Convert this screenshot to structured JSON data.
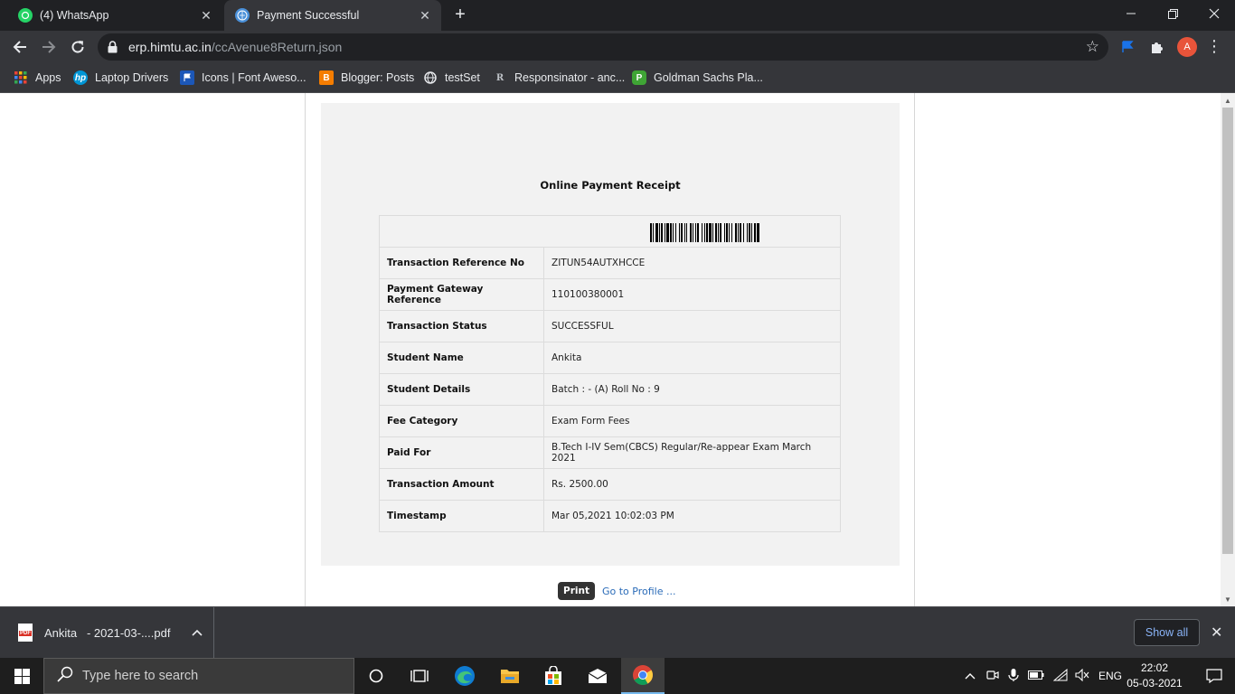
{
  "browser": {
    "tabs": [
      {
        "title": "(4) WhatsApp",
        "icon": "whatsapp-icon"
      },
      {
        "title": "Payment Successful",
        "icon": "site-globe-icon"
      }
    ],
    "url_host": "erp.himtu.ac.in",
    "url_path": "/ccAvenue8Return.json",
    "profile_initial": "A",
    "bookmarks": [
      {
        "label": "Apps",
        "icon": "apps-grid-icon"
      },
      {
        "label": "Laptop Drivers",
        "icon": "hp-logo-icon"
      },
      {
        "label": "Icons | Font Aweso...",
        "icon": "flag-icon"
      },
      {
        "label": "Blogger: Posts",
        "icon": "blogger-icon"
      },
      {
        "label": "testSet",
        "icon": "globe-icon"
      },
      {
        "label": "Responsinator - anc...",
        "icon": "r-logo-icon"
      },
      {
        "label": "Goldman Sachs Pla...",
        "icon": "goldman-sachs-icon"
      }
    ]
  },
  "receipt": {
    "title": "Online Payment Receipt",
    "rows": [
      {
        "label": "Transaction Reference No",
        "value": "ZITUN54AUTXHCCE"
      },
      {
        "label": "Payment Gateway Reference",
        "value": "110100380001"
      },
      {
        "label": "Transaction Status",
        "value": "SUCCESSFUL"
      },
      {
        "label": "Student Name",
        "value": "Ankita"
      },
      {
        "label": "Student Details",
        "value": "Batch : - (A) Roll No : 9"
      },
      {
        "label": "Fee Category",
        "value": "Exam Form Fees"
      },
      {
        "label": "Paid For",
        "value": "B.Tech I-IV Sem(CBCS) Regular/Re-appear Exam March 2021"
      },
      {
        "label": "Transaction Amount",
        "value": "Rs. 2500.00"
      },
      {
        "label": "Timestamp",
        "value": "Mar 05,2021 10:02:03 PM"
      }
    ],
    "print_label": "Print",
    "profile_link": "Go to Profile ..."
  },
  "download_bar": {
    "filename": "Ankita   - 2021-03-....pdf",
    "show_all": "Show all"
  },
  "taskbar": {
    "search_placeholder": "Type here to search",
    "language": "ENG",
    "time": "22:02",
    "date": "05-03-2021"
  },
  "colors": {
    "chrome_dark": "#202124",
    "chrome_toolbar": "#35363a",
    "panel_bg": "#f2f2f2",
    "link": "#2a6bb8",
    "taskbar": "#1e1e1e"
  }
}
